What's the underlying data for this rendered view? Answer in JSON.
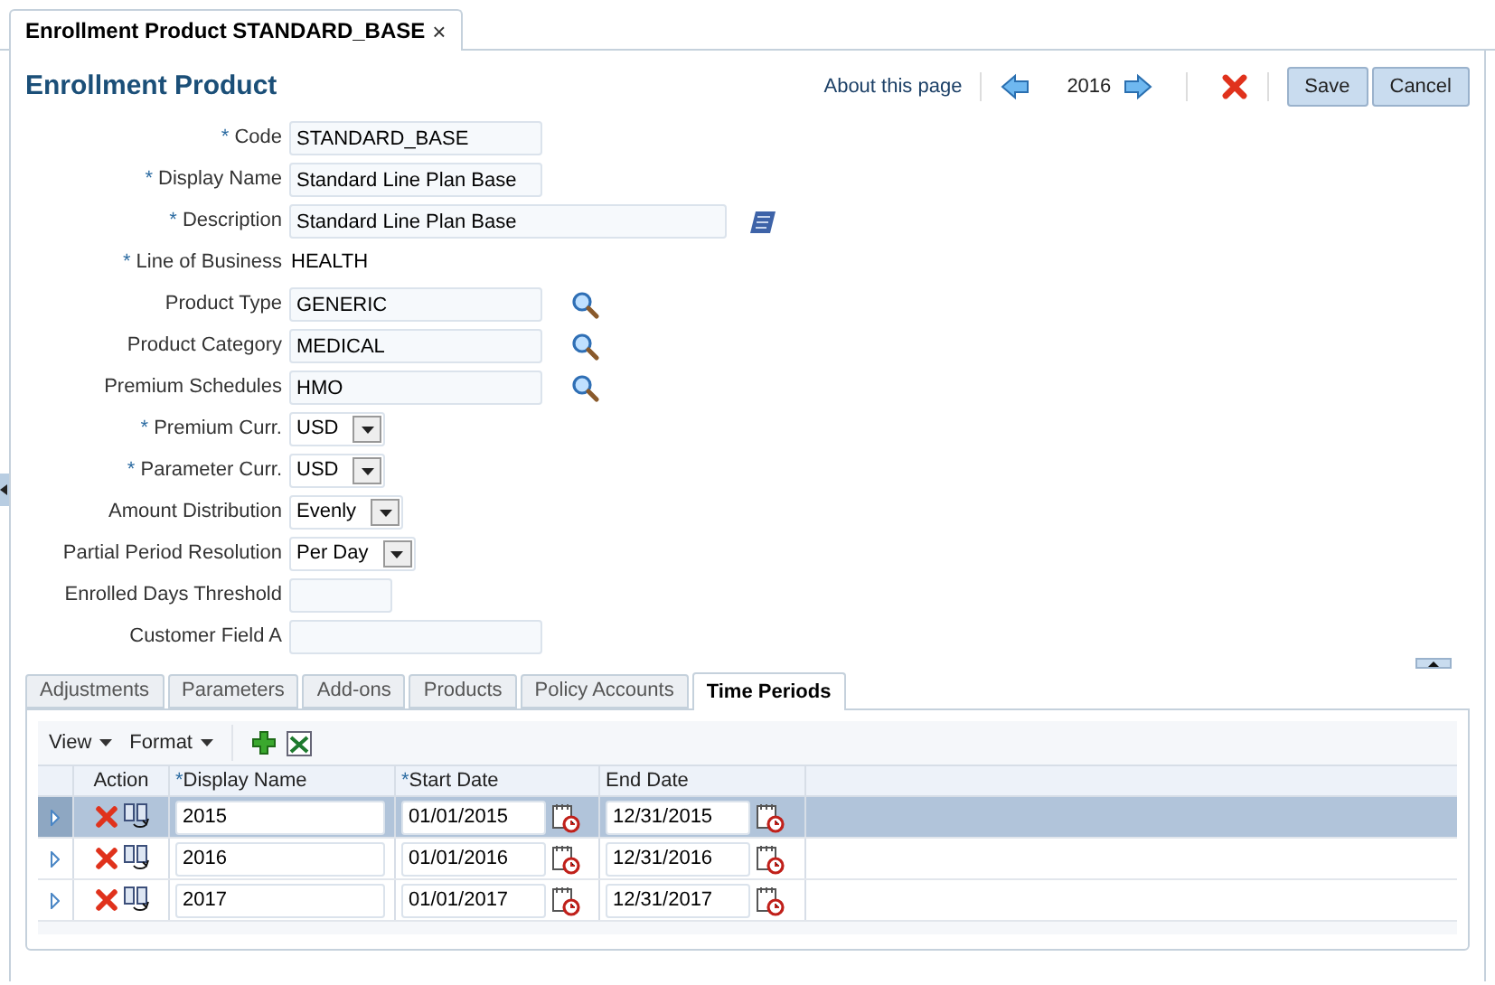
{
  "required_mark": "*",
  "document_tab": {
    "title": "Enrollment Product STANDARD_BASE",
    "close": "×"
  },
  "header": {
    "title": "Enrollment Product",
    "about_link": "About this page",
    "year": "2016",
    "save": "Save",
    "cancel": "Cancel"
  },
  "fields": [
    {
      "label": "Code",
      "required": true,
      "kind": "text",
      "value": "STANDARD_BASE"
    },
    {
      "label": "Display Name",
      "required": true,
      "kind": "text",
      "value": "Standard Line Plan Base"
    },
    {
      "label": "Description",
      "required": true,
      "kind": "note",
      "value": "Standard Line Plan Base"
    },
    {
      "label": "Line of Business",
      "required": true,
      "kind": "display",
      "value": "HEALTH"
    },
    {
      "label": "Product Type",
      "required": false,
      "kind": "lookup",
      "value": "GENERIC"
    },
    {
      "label": "Product Category",
      "required": false,
      "kind": "lookup",
      "value": "MEDICAL"
    },
    {
      "label": "Premium Schedules",
      "required": false,
      "kind": "lookup",
      "value": "HMO"
    },
    {
      "label": "Premium Curr.",
      "required": true,
      "kind": "select",
      "value": "USD"
    },
    {
      "label": "Parameter Curr.",
      "required": true,
      "kind": "select",
      "value": "USD"
    },
    {
      "label": "Amount Distribution",
      "required": false,
      "kind": "select",
      "value": "Evenly"
    },
    {
      "label": "Partial Period Resolution",
      "required": false,
      "kind": "select",
      "value": "Per Day"
    },
    {
      "label": "Enrolled Days Threshold",
      "required": false,
      "kind": "number"
    },
    {
      "label": "Customer Field A",
      "required": false,
      "kind": "text"
    }
  ],
  "tabs": [
    {
      "label": "Adjustments",
      "selected": false
    },
    {
      "label": "Parameters",
      "selected": false
    },
    {
      "label": "Add-ons",
      "selected": false
    },
    {
      "label": "Products",
      "selected": false
    },
    {
      "label": "Policy Accounts",
      "selected": false
    },
    {
      "label": "Time Periods",
      "selected": true
    }
  ],
  "toolbar": {
    "view": "View",
    "format": "Format"
  },
  "table": {
    "columns": [
      {
        "label": "Action",
        "required": false
      },
      {
        "label": "Display Name",
        "required": true
      },
      {
        "label": "Start Date",
        "required": true
      },
      {
        "label": "End Date",
        "required": false
      }
    ],
    "rows": [
      {
        "display_name": "2015",
        "start_date": "01/01/2015",
        "end_date": "12/31/2015",
        "selected": true
      },
      {
        "display_name": "2016",
        "start_date": "01/01/2016",
        "end_date": "12/31/2016",
        "selected": false
      },
      {
        "display_name": "2017",
        "start_date": "01/01/2017",
        "end_date": "12/31/2017",
        "selected": false
      }
    ]
  }
}
